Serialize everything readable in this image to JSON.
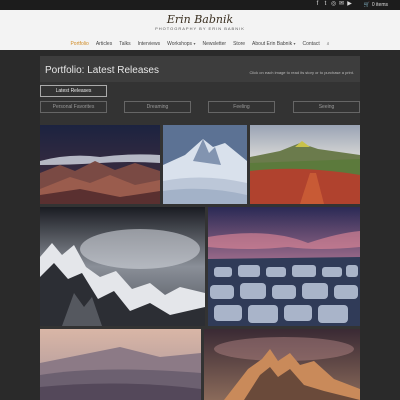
{
  "topbar": {
    "social_icons": [
      "facebook-icon",
      "twitter-icon",
      "instagram-icon",
      "email-icon",
      "youtube-icon"
    ],
    "cart_label": "0 items"
  },
  "site": {
    "logo_script": "Erin Babnik",
    "logo_tagline": "PHOTOGRAPHY BY ERIN BABNIK"
  },
  "nav": {
    "items": [
      "Portfolio",
      "Articles",
      "Talks",
      "Interviews",
      "Workshops",
      "Newsletter",
      "Store",
      "About Erin Babnik",
      "Contact"
    ],
    "active": "Portfolio"
  },
  "page": {
    "title": "Portfolio: Latest Releases",
    "hint": "Click on each image to read its story or to purchase a print."
  },
  "filters": {
    "primary": "Latest Releases",
    "others": [
      "Personal Favorites",
      "Dreaming",
      "Feeling",
      "Seeing"
    ]
  },
  "colors": {
    "accent": "#d08b24",
    "background": "#2a2a2a"
  }
}
